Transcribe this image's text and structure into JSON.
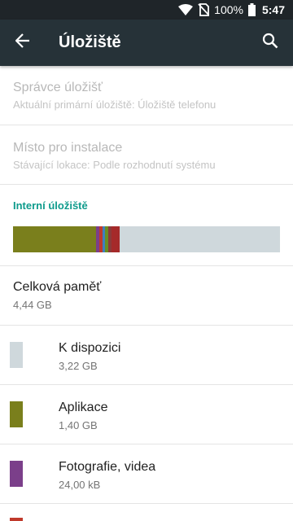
{
  "status_bar": {
    "battery_percent": "100%",
    "time": "5:47",
    "icons": [
      "wifi-icon",
      "no-sim-icon",
      "battery-icon"
    ]
  },
  "toolbar": {
    "title": "Úložiště",
    "icons": [
      "back-arrow-icon",
      "search-icon"
    ]
  },
  "preferences": [
    {
      "title": "Správce úložišť",
      "summary": "Aktuální primární úložiště: Úložiště telefonu"
    },
    {
      "title": "Místo pro instalace",
      "summary": "Stávající lokace: Podle rozhodnutí systému"
    }
  ],
  "internal_storage": {
    "header": "Interní úložiště",
    "usage_segments": [
      {
        "color": "#7a7f1c",
        "fraction": 0.31
      },
      {
        "color": "#7b3f8a",
        "fraction": 0.012
      },
      {
        "color": "#c0392b",
        "fraction": 0.012
      },
      {
        "color": "#3f7fbf",
        "fraction": 0.012
      },
      {
        "color": "#6b8e23",
        "fraction": 0.012
      },
      {
        "color": "#8b3a3a",
        "fraction": 0.012
      },
      {
        "color": "#a52a2a",
        "fraction": 0.03
      },
      {
        "color": "#cfd8dc",
        "fraction": 0.6
      }
    ],
    "total_label": "Celková paměť",
    "total_value": "4,44 GB",
    "categories": [
      {
        "label": "K dispozici",
        "value": "3,22 GB",
        "color": "#cfd8dc"
      },
      {
        "label": "Aplikace",
        "value": "1,40 GB",
        "color": "#7a7f1c"
      },
      {
        "label": "Fotografie, videa",
        "value": "24,00 kB",
        "color": "#7b3f8a"
      }
    ]
  }
}
